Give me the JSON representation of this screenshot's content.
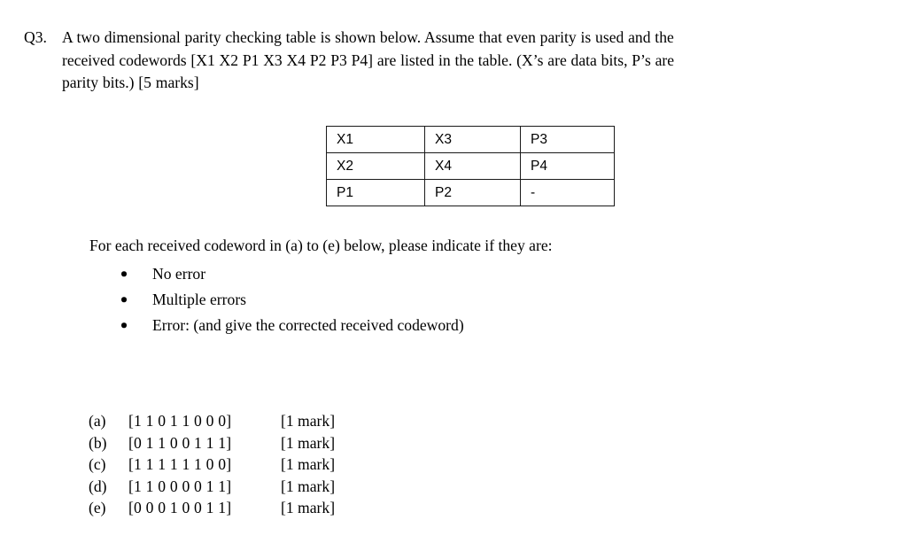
{
  "document": {
    "background_color": "#ffffff",
    "text_color": "#000000"
  },
  "question": {
    "number_label": "Q3.",
    "stem_lines": [
      "A two dimensional parity checking table is shown below. Assume that even parity is used and the",
      "received codewords [X1 X2 P1 X3 X4 P2 P3 P4] are listed in the table. (X’s are data bits, P’s are",
      "parity bits.) [5 marks]"
    ]
  },
  "parity_table": {
    "border_color": "#1a1a1a",
    "rows": [
      [
        "X1",
        "X3",
        "P3"
      ],
      [
        "X2",
        "X4",
        "P4"
      ],
      [
        "P1",
        "P2",
        "-"
      ]
    ]
  },
  "instructions": {
    "lead": "For each received codeword in (a) to (e) below, please indicate if they are:",
    "bullets": [
      "No error",
      "Multiple errors",
      "Error: (and give the corrected received codeword)"
    ]
  },
  "codewords": [
    {
      "label": "(a)",
      "bits": "[1 1 0 1 1 0 0 0]",
      "mark": "[1 mark]"
    },
    {
      "label": "(b)",
      "bits": "[0 1 1 0 0 1 1 1]",
      "mark": "[1 mark]"
    },
    {
      "label": "(c)",
      "bits": "[1 1 1 1 1 1 0 0]",
      "mark": "[1 mark]"
    },
    {
      "label": "(d)",
      "bits": "[1 1 0 0 0 0 1 1]",
      "mark": "[1 mark]"
    },
    {
      "label": "(e)",
      "bits": "[0 0 0 1 0 0 1 1]",
      "mark": "[1 mark]"
    }
  ]
}
